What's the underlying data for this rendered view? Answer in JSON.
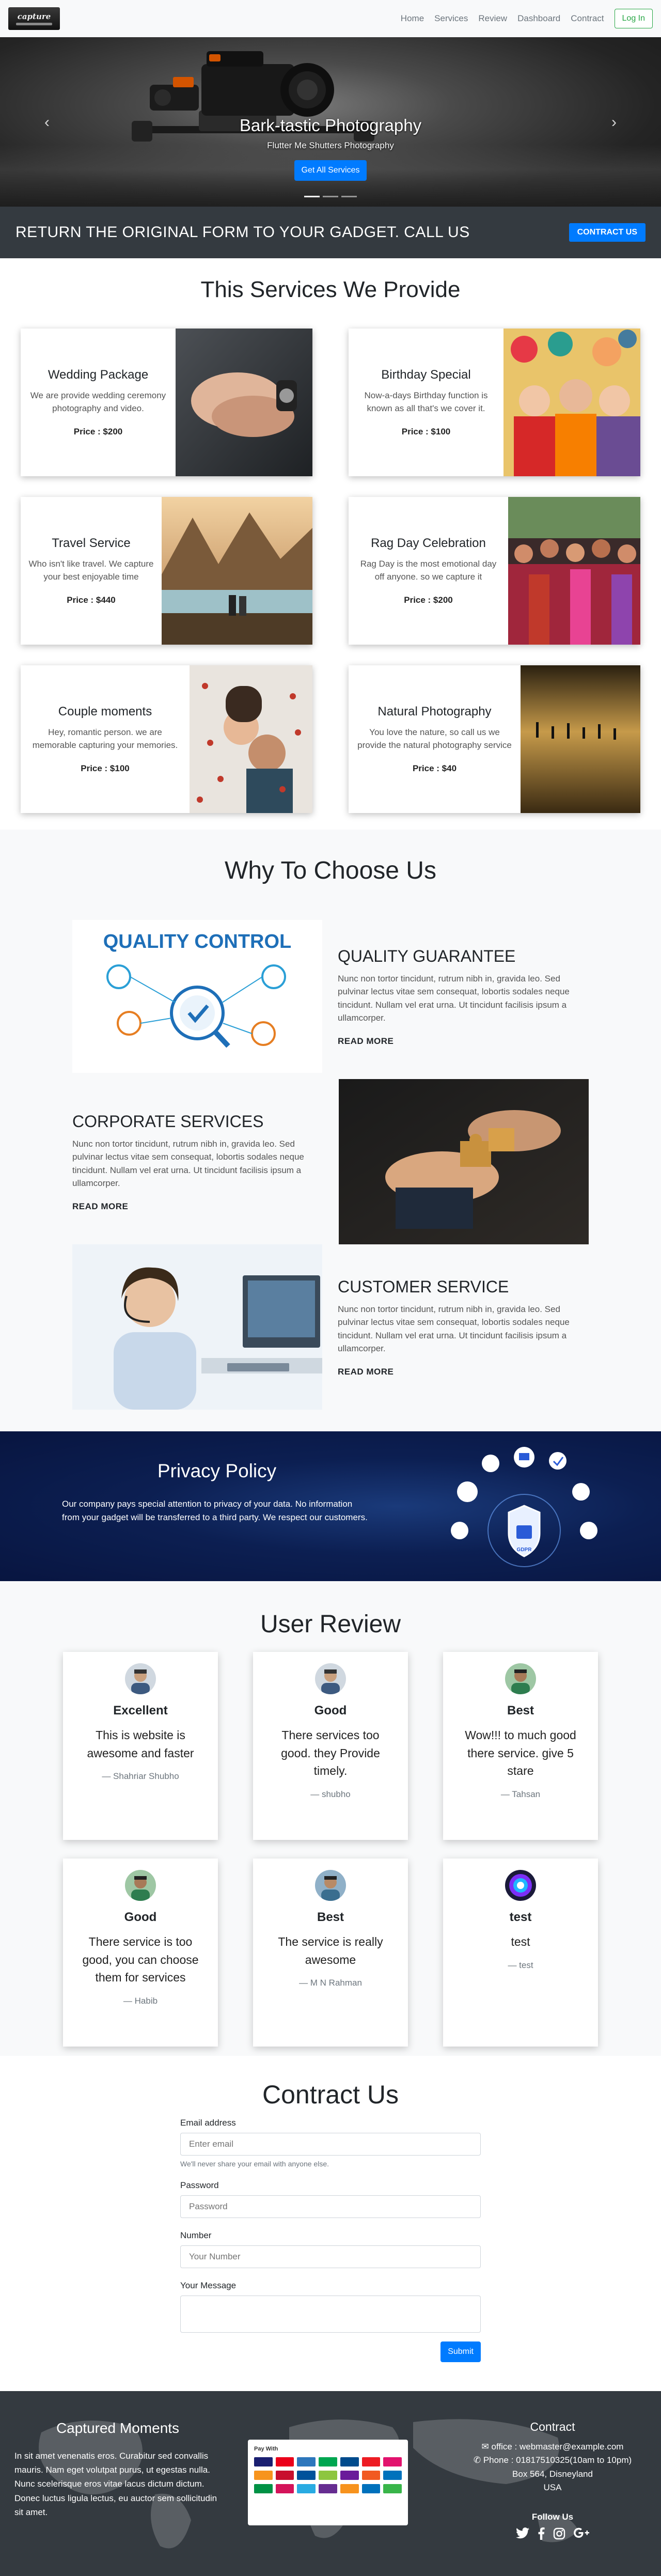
{
  "nav": {
    "brand": "capture",
    "links": [
      "Home",
      "Services",
      "Review",
      "Dashboard",
      "Contract"
    ],
    "login": "Log In"
  },
  "hero": {
    "title": "Bark-tastic Photography",
    "subtitle": "Flutter Me Shutters Photography",
    "button": "Get All Services",
    "prev": "‹",
    "next": "›"
  },
  "cta": {
    "text": "RETURN THE ORIGINAL FORM TO YOUR GADGET. CALL US",
    "button": "CONTRACT US"
  },
  "services": {
    "title": "This Services We Provide",
    "items": [
      {
        "title": "Wedding Package",
        "desc": "We are provide wedding ceremony photography and video.",
        "price": "Price : $200"
      },
      {
        "title": "Birthday Special",
        "desc": "Now-a-days Birthday function is known as all that's we cover it.",
        "price": "Price : $100"
      },
      {
        "title": "Travel Service",
        "desc": "Who isn't like travel. We capture your best enjoyable time",
        "price": "Price : $440"
      },
      {
        "title": "Rag Day Celebration",
        "desc": "Rag Day is the most emotional day off anyone. so we capture it",
        "price": "Price : $200"
      },
      {
        "title": "Couple moments",
        "desc": "Hey, romantic person. we are memorable capturing your memories.",
        "price": "Price : $100"
      },
      {
        "title": "Natural Photography",
        "desc": "You love the nature, so call us we provide the natural photography service",
        "price": "Price : $40"
      }
    ]
  },
  "why": {
    "title": "Why To Choose Us",
    "qc_text": "QUALITY CONTROL",
    "items": [
      {
        "title": "QUALITY GUARANTEE",
        "desc": "Nunc non tortor tincidunt, rutrum nibh in, gravida leo. Sed pulvinar lectus vitae sem consequat, lobortis sodales neque tincidunt. Nullam vel erat urna. Ut tincidunt facilisis ipsum a ullamcorper.",
        "link": "READ MORE"
      },
      {
        "title": "CORPORATE SERVICES",
        "desc": "Nunc non tortor tincidunt, rutrum nibh in, gravida leo. Sed pulvinar lectus vitae sem consequat, lobortis sodales neque tincidunt. Nullam vel erat urna. Ut tincidunt facilisis ipsum a ullamcorper.",
        "link": "READ MORE"
      },
      {
        "title": "CUSTOMER SERVICE",
        "desc": "Nunc non tortor tincidunt, rutrum nibh in, gravida leo. Sed pulvinar lectus vitae sem consequat, lobortis sodales neque tincidunt. Nullam vel erat urna. Ut tincidunt facilisis ipsum a ullamcorper.",
        "link": "READ MORE"
      }
    ]
  },
  "privacy": {
    "title": "Privacy Policy",
    "text": "Our company pays special attention to privacy of your data. No information from your gadget will be transferred to a third party. We respect our customers.",
    "badge": "GDPR"
  },
  "reviews": {
    "title": "User Review",
    "items": [
      {
        "rating": "Excellent",
        "text": "This is website is awesome and faster",
        "author": "— Shahriar Shubho"
      },
      {
        "rating": "Good",
        "text": "There services too good. they Provide timely.",
        "author": "— shubho"
      },
      {
        "rating": "Best",
        "text": "Wow!!! to much good there service. give 5 stare",
        "author": "— Tahsan"
      },
      {
        "rating": "Good",
        "text": "There service is too good, you can choose them for services",
        "author": "— Habib"
      },
      {
        "rating": "Best",
        "text": "The service is really awesome",
        "author": "— M N Rahman"
      },
      {
        "rating": "test",
        "text": "test",
        "author": "— test"
      }
    ]
  },
  "contact": {
    "title": "Contract Us",
    "email_label": "Email address",
    "email_placeholder": "Enter email",
    "email_help": "We'll never share your email with anyone else.",
    "password_label": "Password",
    "password_placeholder": "Password",
    "number_label": "Number",
    "number_placeholder": "Your Number",
    "message_label": "Your Message",
    "submit": "Submit"
  },
  "footer": {
    "about_title": "Captured Moments",
    "about_text": "In sit amet venenatis eros. Curabitur sed convallis mauris. Nam eget volutpat purus, ut egestas nulla. Nunc scelerisque eros vitae lacus dictum dictum. Donec luctus ligula lectus, eu auctor sem sollicitudin sit amet.",
    "pay_title": "Pay With",
    "contact_title": "Contract",
    "office": "office : webmaster@example.com",
    "phone": "Phone : 01817510325(10am to 10pm)",
    "address1": "Box 564, Disneyland",
    "address2": "USA",
    "follow": "Follow Us"
  },
  "colors": {
    "primary": "#007bff",
    "dark": "#343a40",
    "success": "#28a745",
    "navy": "#0c1f52"
  }
}
